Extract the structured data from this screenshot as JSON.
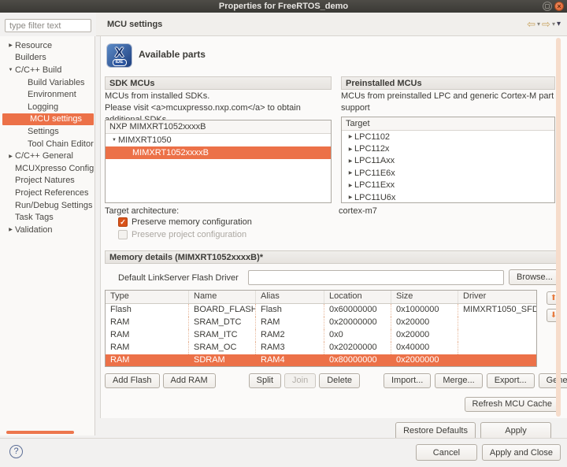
{
  "window": {
    "title": "Properties for FreeRTOS_demo"
  },
  "header": {
    "title": "MCU settings"
  },
  "icons": {
    "chevron_right": "▶",
    "chevron_down": "▼",
    "back": "⇦",
    "forward": "⇨",
    "dropdown": "▾",
    "view_menu": "▾",
    "arrow_up": "⬆",
    "arrow_down": "⬇",
    "check": "✓",
    "close": "×",
    "help": "?",
    "ide_badge": "IDE",
    "logo_x": "X"
  },
  "sidebar": {
    "filter_placeholder": "type filter text",
    "items": [
      {
        "label": "Resource"
      },
      {
        "label": "Builders"
      },
      {
        "label": "C/C++ Build"
      },
      {
        "label": "Build Variables"
      },
      {
        "label": "Environment"
      },
      {
        "label": "Logging"
      },
      {
        "label": "MCU settings",
        "selected": true
      },
      {
        "label": "Settings"
      },
      {
        "label": "Tool Chain Editor"
      },
      {
        "label": "C/C++ General"
      },
      {
        "label": "MCUXpresso Config To"
      },
      {
        "label": "Project Natures"
      },
      {
        "label": "Project References"
      },
      {
        "label": "Run/Debug Settings"
      },
      {
        "label": "Task Tags"
      },
      {
        "label": "Validation"
      }
    ]
  },
  "page": {
    "banner_title": "Available parts",
    "sdk": {
      "title": "SDK MCUs",
      "desc_lines": [
        "MCUs from installed SDKs.",
        "Please visit <a>mcuxpresso.nxp.com</a> to obtain",
        "additional SDKs."
      ],
      "tree_header": "NXP MIMXRT1052xxxxB",
      "parent": "MIMXRT1050",
      "selected": "MIMXRT1052xxxxB"
    },
    "preinstalled": {
      "title": "Preinstalled MCUs",
      "desc_lines": [
        "MCUs from preinstalled LPC and generic Cortex-M part",
        "support"
      ],
      "column": "Target",
      "rows": [
        "LPC1102",
        "LPC112x",
        "LPC11Axx",
        "LPC11E6x",
        "LPC11Exx",
        "LPC11U6x"
      ]
    },
    "target_architecture": {
      "label": "Target architecture:",
      "value": "cortex-m7"
    },
    "checkboxes": [
      {
        "label": "Preserve memory configuration",
        "checked": true,
        "disabled": false
      },
      {
        "label": "Preserve project configuration",
        "checked": false,
        "disabled": true
      }
    ],
    "memory": {
      "title": "Memory details (MIMXRT1052xxxxB)*",
      "driver_label": "Default LinkServer Flash Driver",
      "driver_value": "",
      "browse_label": "Browse...",
      "table": {
        "columns": [
          "Type",
          "Name",
          "Alias",
          "Location",
          "Size",
          "Driver"
        ],
        "rows": [
          [
            "Flash",
            "BOARD_FLASH",
            "Flash",
            "0x60000000",
            "0x1000000",
            "MIMXRT1050_SFD"
          ],
          [
            "RAM",
            "SRAM_DTC",
            "RAM",
            "0x20000000",
            "0x20000",
            ""
          ],
          [
            "RAM",
            "SRAM_ITC",
            "RAM2",
            "0x0",
            "0x20000",
            ""
          ],
          [
            "RAM",
            "SRAM_OC",
            "RAM3",
            "0x20200000",
            "0x40000",
            ""
          ],
          [
            "RAM",
            "SDRAM",
            "RAM4",
            "0x80000000",
            "0x2000000",
            ""
          ]
        ],
        "selected_row_index": 4
      },
      "buttons": [
        "Add Flash",
        "Add RAM",
        "Split",
        "Join",
        "Delete",
        "Import...",
        "Merge...",
        "Export...",
        "Generate..."
      ],
      "refresh_label": "Refresh MCU Cache"
    },
    "restore_defaults_label": "Restore Defaults",
    "apply_label": "Apply"
  },
  "footer": {
    "cancel_label": "Cancel",
    "apply_close_label": "Apply and Close"
  },
  "colors": {
    "selection_orange": "#EC7148",
    "checkbox_orange": "#D9531A",
    "close_button_orange": "#E8663A",
    "scrollbar_thumb_orange": "#ED764D",
    "scrollbar_track_pink": "#F6DCCB",
    "titlebar_dark": "#3A3935",
    "logo_blue": "#2B55A0"
  }
}
